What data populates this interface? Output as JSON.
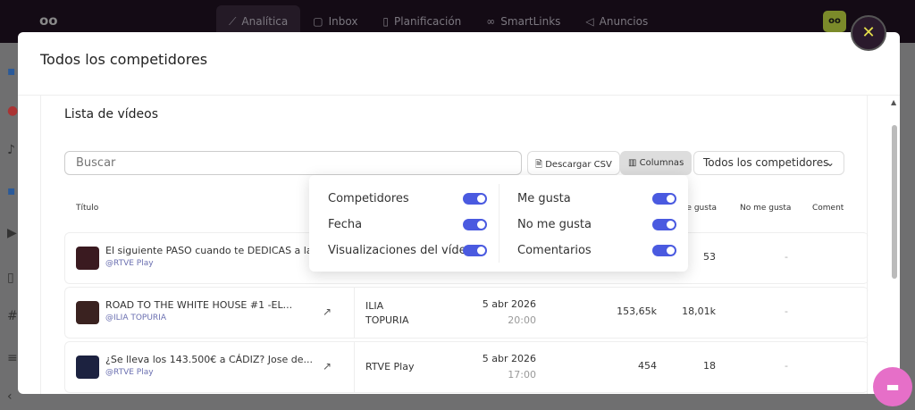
{
  "topbar": {
    "logo": "oo",
    "nav": [
      {
        "label": "Analítica",
        "icon": "chart-line-icon",
        "active": true
      },
      {
        "label": "Inbox",
        "icon": "chat-icon"
      },
      {
        "label": "Planificación",
        "icon": "calendar-icon"
      },
      {
        "label": "SmartLinks",
        "icon": "link-icon"
      },
      {
        "label": "Anuncios",
        "icon": "megaphone-icon"
      }
    ],
    "avatar": "oo"
  },
  "modal": {
    "title": "Todos los competidores",
    "close": "✕"
  },
  "card": {
    "title": "Lista de vídeos",
    "search_placeholder": "Buscar",
    "csv": "Descargar CSV",
    "columns": "Columnas",
    "filter": "Todos los competidores"
  },
  "table": {
    "headers": {
      "title": "Título",
      "likes": "Me gusta",
      "dislikes": "No me gusta",
      "comments": "Coment"
    },
    "rows": [
      {
        "title": "El siguiente PASO cuando te DEDICAS a la...",
        "user": "@RTVE Play",
        "competitor": "",
        "date": "",
        "time": "",
        "views": "",
        "likes": "53",
        "dislikes": "-"
      },
      {
        "title": "ROAD TO THE WHITE HOUSE #1 -EL...",
        "user": "@ILIA TOPURIA",
        "competitor": "ILIA\nTOPURIA",
        "date": "5 abr 2026",
        "time": "20:00",
        "views": "153,65k",
        "likes": "18,01k",
        "dislikes": "-"
      },
      {
        "title": "¿Se lleva los 143.500€ a CÁDIZ?  Jose de...",
        "user": "@RTVE Play",
        "competitor": "RTVE Play",
        "date": "5 abr 2026",
        "time": "17:00",
        "views": "454",
        "likes": "18",
        "dislikes": "-"
      }
    ]
  },
  "columns_popup": {
    "left": [
      {
        "label": "Competidores",
        "on": true
      },
      {
        "label": "Fecha",
        "on": true
      },
      {
        "label": "Visualizaciones del vídeo",
        "on": true
      }
    ],
    "right": [
      {
        "label": "Me gusta",
        "on": true
      },
      {
        "label": "No me gusta",
        "on": true
      },
      {
        "label": "Comentarios",
        "on": true
      }
    ]
  },
  "colors": {
    "accent": "#4a5ae0",
    "topbar": "#140b15",
    "chat": "#e66fc8"
  }
}
